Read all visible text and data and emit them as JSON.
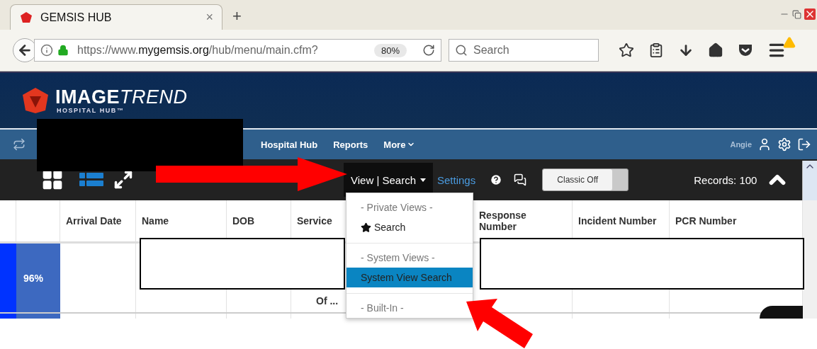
{
  "browser": {
    "tab": {
      "title": "GEMSIS HUB",
      "close": "×"
    },
    "new_tab": "+",
    "url": {
      "prefix": "https://www.",
      "domain": "mygemsis.org",
      "path": "/hub/menu/main.cfm?"
    },
    "zoom": "80%",
    "search": {
      "placeholder": "Search"
    }
  },
  "brand": {
    "word_1": "IMAGE",
    "word_2": "TREND",
    "subtitle": "HOSPITAL HUB™"
  },
  "nav": {
    "items": [
      "Hospital Hub",
      "Reports",
      "More"
    ],
    "user": "Angie"
  },
  "toolbar": {
    "view_menu": "View | Search",
    "settings": "Settings",
    "toggle": {
      "label": "Classic Off",
      "on": false
    },
    "records": "Records: 100"
  },
  "table": {
    "columns": [
      "Arrival Date",
      "Name",
      "DOB",
      "Service",
      "Response Number",
      "Incident Number",
      "PCR Number"
    ],
    "rows": [
      {
        "kind": "full",
        "score": "96%",
        "service": "Of ..."
      },
      {
        "kind": "partial"
      }
    ]
  },
  "menu": [
    {
      "kind": "header",
      "label": "- Private Views -"
    },
    {
      "kind": "item",
      "label": "Search",
      "starred": true,
      "selected": false
    },
    {
      "kind": "divider"
    },
    {
      "kind": "header",
      "label": "- System Views -"
    },
    {
      "kind": "item",
      "label": "System View Search",
      "starred": false,
      "selected": true
    },
    {
      "kind": "divider"
    },
    {
      "kind": "header",
      "label": "- Built-In -"
    }
  ]
}
